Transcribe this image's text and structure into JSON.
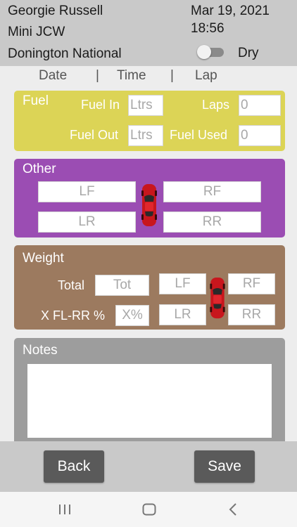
{
  "header": {
    "driver": "Georgie Russell",
    "car": "Mini JCW",
    "track": "Donington National",
    "date": "Mar 19, 2021",
    "time": "18:56",
    "condition_label": "Dry",
    "condition_toggle_on": false
  },
  "subnav": {
    "date": "Date",
    "sep1": "|",
    "time": "Time",
    "sep2": "|",
    "lap": "Lap"
  },
  "fuel": {
    "title": "Fuel",
    "fuel_in_label": "Fuel In",
    "fuel_in_placeholder": "Ltrs",
    "laps_label": "Laps",
    "laps_placeholder": "0",
    "fuel_out_label": "Fuel Out",
    "fuel_out_placeholder": "Ltrs",
    "fuel_used_label": "Fuel Used",
    "fuel_used_placeholder": "0"
  },
  "other": {
    "title": "Other",
    "lf_placeholder": "LF",
    "rf_placeholder": "RF",
    "lr_placeholder": "LR",
    "rr_placeholder": "RR"
  },
  "weight": {
    "title": "Weight",
    "total_label": "Total",
    "total_placeholder": "Tot",
    "cross_label": "X  FL-RR %",
    "cross_placeholder": "X%",
    "lf_placeholder": "LF",
    "rf_placeholder": "RF",
    "lr_placeholder": "LR",
    "rr_placeholder": "RR"
  },
  "notes": {
    "title": "Notes",
    "value": ""
  },
  "footer": {
    "back_label": "Back",
    "save_label": "Save"
  },
  "colors": {
    "header_bg": "#c9c9c9",
    "fuel_panel": "#dcd456",
    "other_panel": "#9b4db3",
    "weight_panel": "#9c7a5f",
    "notes_panel": "#9d9d9d",
    "button_bg": "#5a5a5a",
    "car_red": "#c8161d"
  },
  "icons": {
    "car": "car-top-view-icon",
    "nav_recents": "recents-icon",
    "nav_home": "home-icon",
    "nav_back": "back-icon"
  }
}
